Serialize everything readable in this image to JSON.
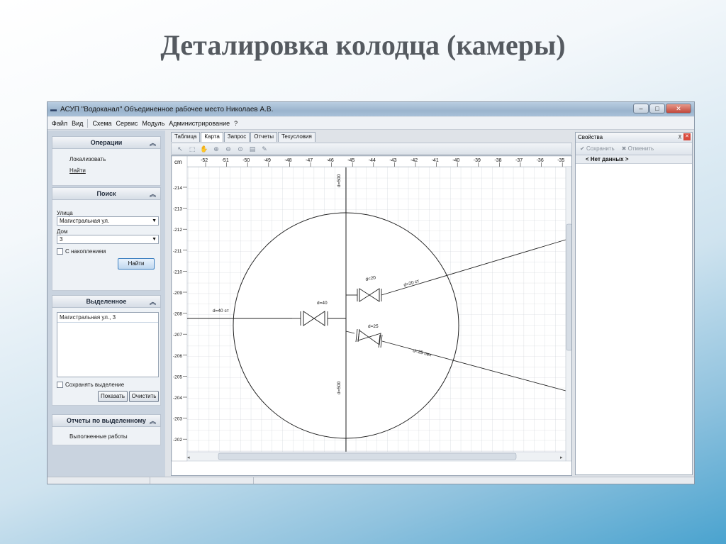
{
  "slide": {
    "title": "Деталировка колодца (камеры)"
  },
  "window": {
    "title": "АСУП \"Водоканал\" Объединенное рабочее место Николаев А.В.",
    "controls": {
      "minimize": "–",
      "maximize": "□",
      "close": "✕"
    }
  },
  "menu": [
    "Файл",
    "Вид",
    "Схема",
    "Сервис",
    "Модуль",
    "Администрирование",
    "?"
  ],
  "left_panel": {
    "operations": {
      "header": "Операции",
      "items": [
        "Локализовать",
        "Найти"
      ]
    },
    "search": {
      "header": "Поиск",
      "street_label": "Улица",
      "street_value": "Магистральная ул.",
      "house_label": "Дом",
      "house_value": "3",
      "accumulate_label": "С накоплением",
      "find_button": "Найти"
    },
    "selected": {
      "header": "Выделенное",
      "items": [
        "Магистральная ул., 3"
      ],
      "save_label": "Сохранять выделение",
      "show_button": "Показать",
      "clear_button": "Очистить"
    },
    "reports": {
      "header": "Отчеты по выделенному",
      "items": [
        "Выполненные работы"
      ]
    }
  },
  "tabs": [
    "Таблица",
    "Карта",
    "Запрос",
    "Отчеты",
    "Техусловия"
  ],
  "map": {
    "unit": "cm",
    "x_ticks": [
      "-52",
      "-51",
      "-50",
      "-49",
      "-48",
      "-47",
      "-46",
      "-45",
      "-44",
      "-43",
      "-42",
      "-41",
      "-40",
      "-39",
      "-38",
      "-37",
      "-36",
      "-35"
    ],
    "y_ticks": [
      "-214",
      "-213",
      "-212",
      "-211",
      "-210",
      "-209",
      "-208",
      "-207",
      "-206",
      "-205",
      "-204",
      "-203",
      "-202"
    ],
    "labels": {
      "top_pipe": "d=500",
      "bottom_pipe": "d=500",
      "left_pipe": "d=40 ст",
      "center_valve": "d=40",
      "upper_valve": "d=20",
      "upper_pipe": "d=20 ст",
      "lower_valve": "d=25",
      "lower_pipe": "d=25 пвх"
    }
  },
  "right_panel": {
    "title": "Свойства",
    "save_button": "Сохранить",
    "cancel_button": "Отменить",
    "no_data": "< Нет данных >"
  }
}
